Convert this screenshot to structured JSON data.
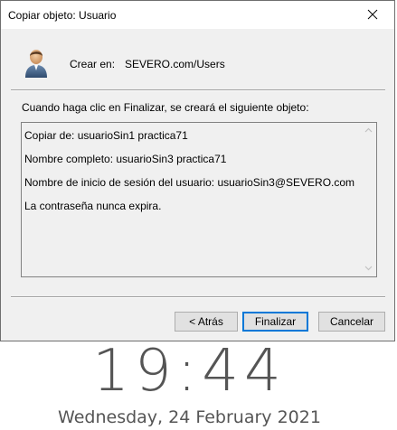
{
  "window": {
    "title": "Copiar objeto: Usuario"
  },
  "header": {
    "create_in_label": "Crear en:",
    "create_in_value": "SEVERO.com/Users"
  },
  "intro_text": "Cuando haga clic en Finalizar, se creará el siguiente objeto:",
  "summary": {
    "lines": [
      "Copiar de: usuarioSin1 practica71",
      "Nombre completo: usuarioSin3 practica71",
      "Nombre de inicio de sesión del usuario: usuarioSin3@SEVERO.com",
      "La contraseña nunca expira."
    ]
  },
  "buttons": {
    "back": "< Atrás",
    "finish": "Finalizar",
    "cancel": "Cancelar"
  },
  "clock": {
    "time": "19:44",
    "date": "Wednesday, 24 February 2021"
  },
  "icons": {
    "close": "close-icon",
    "user": "user-icon",
    "scroll_up": "chevron-up-icon",
    "scroll_down": "chevron-down-icon"
  }
}
